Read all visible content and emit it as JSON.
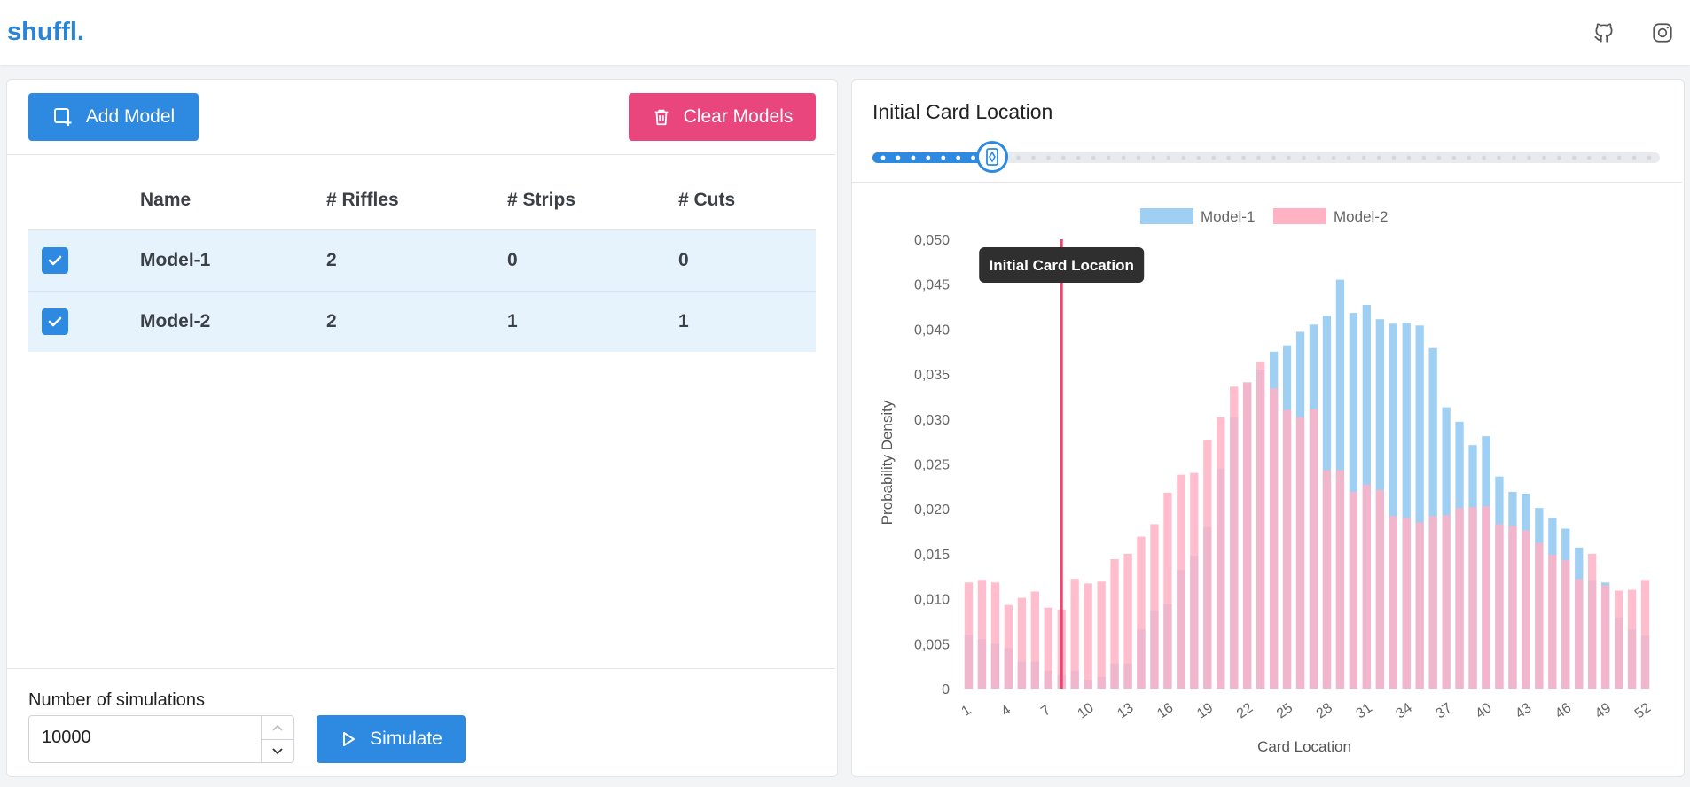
{
  "app": {
    "logo": "shuffl."
  },
  "header": {
    "icons": [
      "github-icon",
      "instagram-icon"
    ]
  },
  "models_panel": {
    "add_label": "Add Model",
    "clear_label": "Clear Models",
    "columns": [
      "Name",
      "# Riffles",
      "# Strips",
      "# Cuts"
    ],
    "rows": [
      {
        "checked": true,
        "name": "Model-1",
        "riffles": "2",
        "strips": "0",
        "cuts": "0"
      },
      {
        "checked": true,
        "name": "Model-2",
        "riffles": "2",
        "strips": "1",
        "cuts": "1"
      }
    ]
  },
  "simulation": {
    "label": "Number of simulations",
    "value": "10000",
    "button_label": "Simulate"
  },
  "chart_panel": {
    "title": "Initial Card Location",
    "slider": {
      "min": 1,
      "max": 52,
      "value": 8
    },
    "tooltip": "Initial Card Location"
  },
  "colors": {
    "accent": "#2d8ae0",
    "danger": "#e8467c",
    "model1": "#9fd0f4",
    "model2": "#ffb2c4",
    "marker": "#f0446e"
  },
  "chart_data": {
    "type": "bar",
    "xlabel": "Card Location",
    "ylabel": "Probability Density",
    "ylim": [
      0,
      0.05
    ],
    "yticks": [
      "0",
      "0,005",
      "0,010",
      "0,015",
      "0,020",
      "0,025",
      "0,030",
      "0,035",
      "0,040",
      "0,045",
      "0,050"
    ],
    "xticks": [
      "1",
      "4",
      "7",
      "10",
      "13",
      "16",
      "19",
      "22",
      "25",
      "28",
      "31",
      "34",
      "37",
      "40",
      "43",
      "46",
      "49",
      "52"
    ],
    "legend_position": "top",
    "marker_x": 8,
    "categories": [
      1,
      2,
      3,
      4,
      5,
      6,
      7,
      8,
      9,
      10,
      11,
      12,
      13,
      14,
      15,
      16,
      17,
      18,
      19,
      20,
      21,
      22,
      23,
      24,
      25,
      26,
      27,
      28,
      29,
      30,
      31,
      32,
      33,
      34,
      35,
      36,
      37,
      38,
      39,
      40,
      41,
      42,
      43,
      44,
      45,
      46,
      47,
      48,
      49,
      50,
      51,
      52
    ],
    "series": [
      {
        "name": "Model-1",
        "values": [
          0.006,
          0.0055,
          0.005,
          0.0045,
          0.003,
          0.003,
          0.002,
          0.0015,
          0.002,
          0.001,
          0.0013,
          0.0028,
          0.0028,
          0.0066,
          0.0087,
          0.0094,
          0.0132,
          0.0148,
          0.018,
          0.0245,
          0.0302,
          0.034,
          0.0355,
          0.0375,
          0.0382,
          0.0397,
          0.0405,
          0.0415,
          0.0455,
          0.0418,
          0.0427,
          0.0411,
          0.0406,
          0.0407,
          0.0404,
          0.0379,
          0.0313,
          0.0297,
          0.0271,
          0.0281,
          0.0236,
          0.0219,
          0.0217,
          0.0201,
          0.019,
          0.0178,
          0.0157,
          0.0121,
          0.0118,
          0.0079,
          0.0066,
          0.0059
        ]
      },
      {
        "name": "Model-2",
        "values": [
          0.0118,
          0.0121,
          0.0118,
          0.0093,
          0.0101,
          0.0108,
          0.009,
          0.0088,
          0.0122,
          0.0117,
          0.0119,
          0.0144,
          0.015,
          0.0169,
          0.0183,
          0.0218,
          0.0238,
          0.024,
          0.0277,
          0.0302,
          0.0336,
          0.0341,
          0.0364,
          0.0334,
          0.031,
          0.0302,
          0.0311,
          0.0243,
          0.0243,
          0.0219,
          0.0227,
          0.0221,
          0.0192,
          0.019,
          0.0185,
          0.0192,
          0.0193,
          0.0201,
          0.0202,
          0.0203,
          0.0183,
          0.0181,
          0.0176,
          0.0162,
          0.0149,
          0.0143,
          0.0122,
          0.015,
          0.0115,
          0.0109,
          0.011,
          0.0121
        ]
      }
    ]
  }
}
